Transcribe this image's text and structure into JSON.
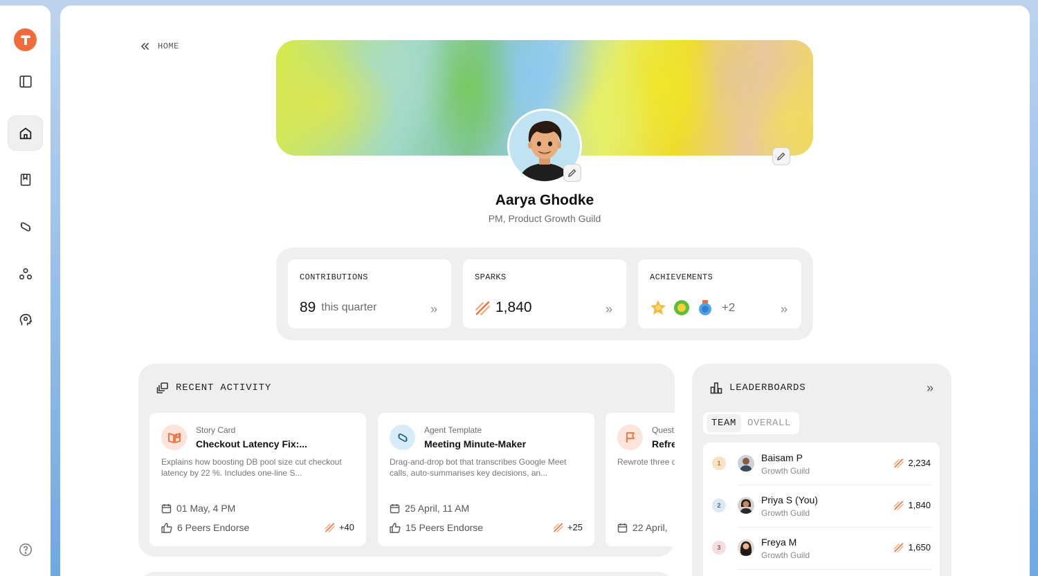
{
  "breadcrumb": {
    "label": "HOME"
  },
  "profile": {
    "name": "Aarya Ghodke",
    "role": "PM, Product Growth Guild"
  },
  "stats": {
    "contributions": {
      "label": "CONTRIBUTIONS",
      "value": "89",
      "suffix": "this quarter"
    },
    "sparks": {
      "label": "SPARKS",
      "value": "1,840"
    },
    "achievements": {
      "label": "ACHIEVEMENTS",
      "more": "+2"
    },
    "chevron": "»"
  },
  "activity": {
    "title": "RECENT ACTIVITY",
    "cards": [
      {
        "type": "Story Card",
        "title": "Checkout Latency Fix:...",
        "desc": "Explains how boosting DB pool size cut checkout latency by 22 %. Includes one-line S...",
        "date": "01 May, 4 PM",
        "endorse": "6 Peers Endorse",
        "sparks": "+40"
      },
      {
        "type": "Agent Template",
        "title": "Meeting Minute-Maker",
        "desc": "Drag-and-drop bot that transcribes Google Meet calls, auto-summarises key decisions, an...",
        "date": "25 April, 11 AM",
        "endorse": "15 Peers Endorse",
        "sparks": "+25"
      },
      {
        "type": "Quest",
        "title": "Refre",
        "desc": "Rewrote three duplicates, ad",
        "date": "22 April,"
      }
    ]
  },
  "leaderboards": {
    "title": "LEADERBOARDS",
    "chevron": "»",
    "tabs": [
      "TEAM",
      "OVERALL"
    ],
    "active_tab": "TEAM",
    "rows": [
      {
        "rank": "1",
        "name": "Baisam P",
        "team": "Growth Guild",
        "score": "2,234"
      },
      {
        "rank": "2",
        "name": "Priya S (You)",
        "team": "Growth Guild",
        "score": "1,840"
      },
      {
        "rank": "3",
        "name": "Freya M",
        "team": "Growth Guild",
        "score": "1,650"
      }
    ]
  },
  "colors": {
    "brand": "#f26b3a",
    "spark": "#f26b3a",
    "rank1": "#f6e2c6",
    "rank2": "#dde8f2",
    "rank3": "#f4dede"
  },
  "icons": {
    "sidebar": [
      "sidebar-toggle-icon",
      "home-icon",
      "bookmark-icon",
      "agents-icon",
      "community-icon",
      "ideas-icon",
      "help-icon"
    ]
  }
}
